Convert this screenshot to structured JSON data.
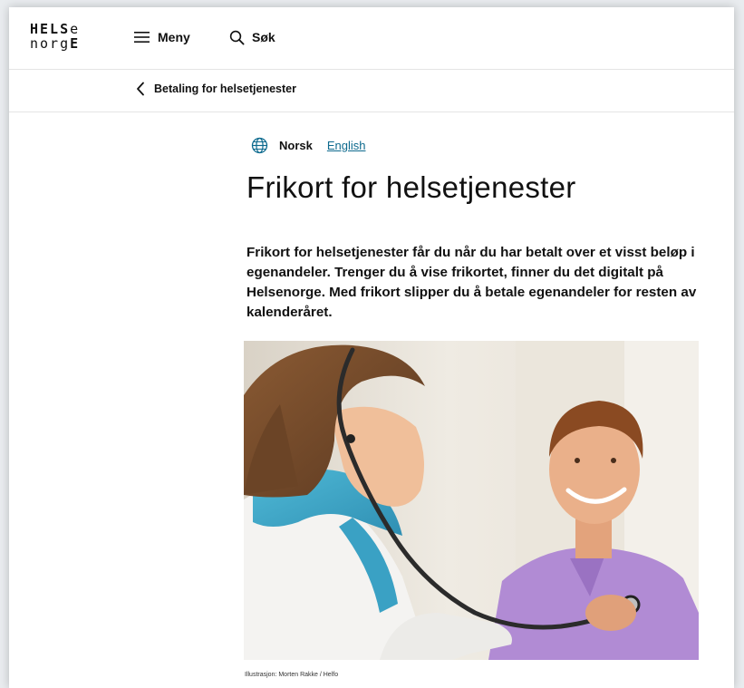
{
  "header": {
    "logo": {
      "line1": "HELSe",
      "line2": "norgE"
    },
    "menu_label": "Meny",
    "search_label": "Søk"
  },
  "breadcrumb": {
    "back_label": "Betaling for helsetjenester"
  },
  "language": {
    "current": "Norsk",
    "alternate": "English"
  },
  "article": {
    "title": "Frikort for helsetjenester",
    "lead": "Frikort for helsetjenester får du når du har betalt over et visst beløp i egenandeler. Trenger du å vise frikortet, finner du det digitalt på Helsenorge. Med frikort slipper du å betale egenandeler for resten av kalenderåret.",
    "image_caption": "Illustrasjon: Morten Rakke / Helfo"
  },
  "icons": {
    "menu": "hamburger-icon",
    "search": "magnifier-icon",
    "back": "chevron-left-icon",
    "language": "globe-icon"
  },
  "colors": {
    "link": "#0d6a8e",
    "globe": "#0d6a8e",
    "text": "#111111"
  }
}
